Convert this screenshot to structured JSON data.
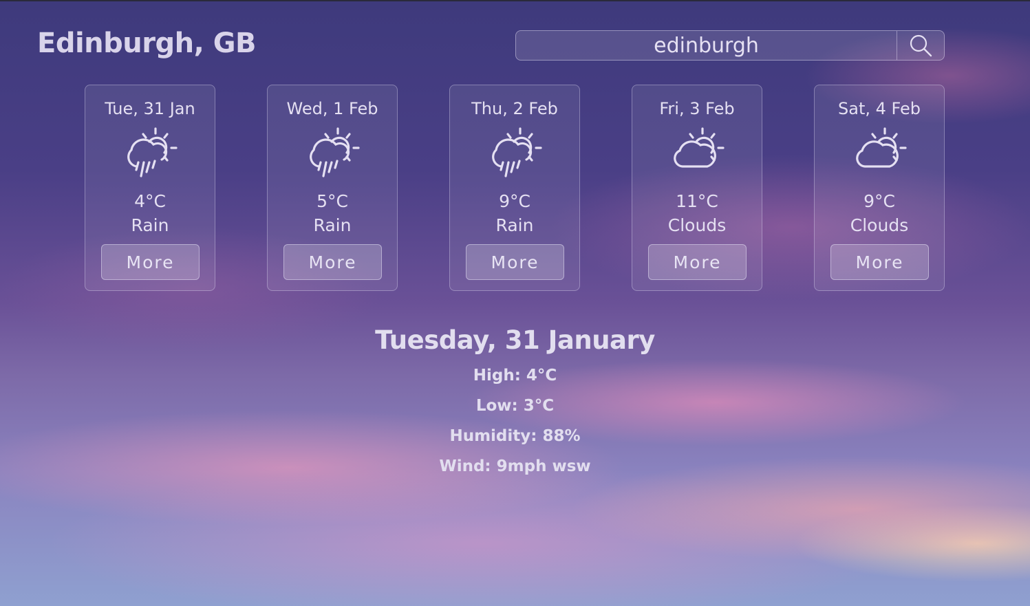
{
  "header": {
    "city": "Edinburgh, GB"
  },
  "search": {
    "value": "edinburgh",
    "icon": "search-icon"
  },
  "forecast": [
    {
      "date": "Tue, 31 Jan",
      "temp": "4°C",
      "condition": "Rain",
      "icon": "rain-sun-icon",
      "button": "More"
    },
    {
      "date": "Wed, 1 Feb",
      "temp": "5°C",
      "condition": "Rain",
      "icon": "rain-sun-icon",
      "button": "More"
    },
    {
      "date": "Thu, 2 Feb",
      "temp": "9°C",
      "condition": "Rain",
      "icon": "rain-sun-icon",
      "button": "More"
    },
    {
      "date": "Fri, 3 Feb",
      "temp": "11°C",
      "condition": "Clouds",
      "icon": "cloud-sun-icon",
      "button": "More"
    },
    {
      "date": "Sat, 4 Feb",
      "temp": "9°C",
      "condition": "Clouds",
      "icon": "cloud-sun-icon",
      "button": "More"
    }
  ],
  "details": {
    "title": "Tuesday, 31 January",
    "high": "High: 4°C",
    "low": "Low: 3°C",
    "humidity": "Humidity: 88%",
    "wind": "Wind: 9mph wsw"
  }
}
